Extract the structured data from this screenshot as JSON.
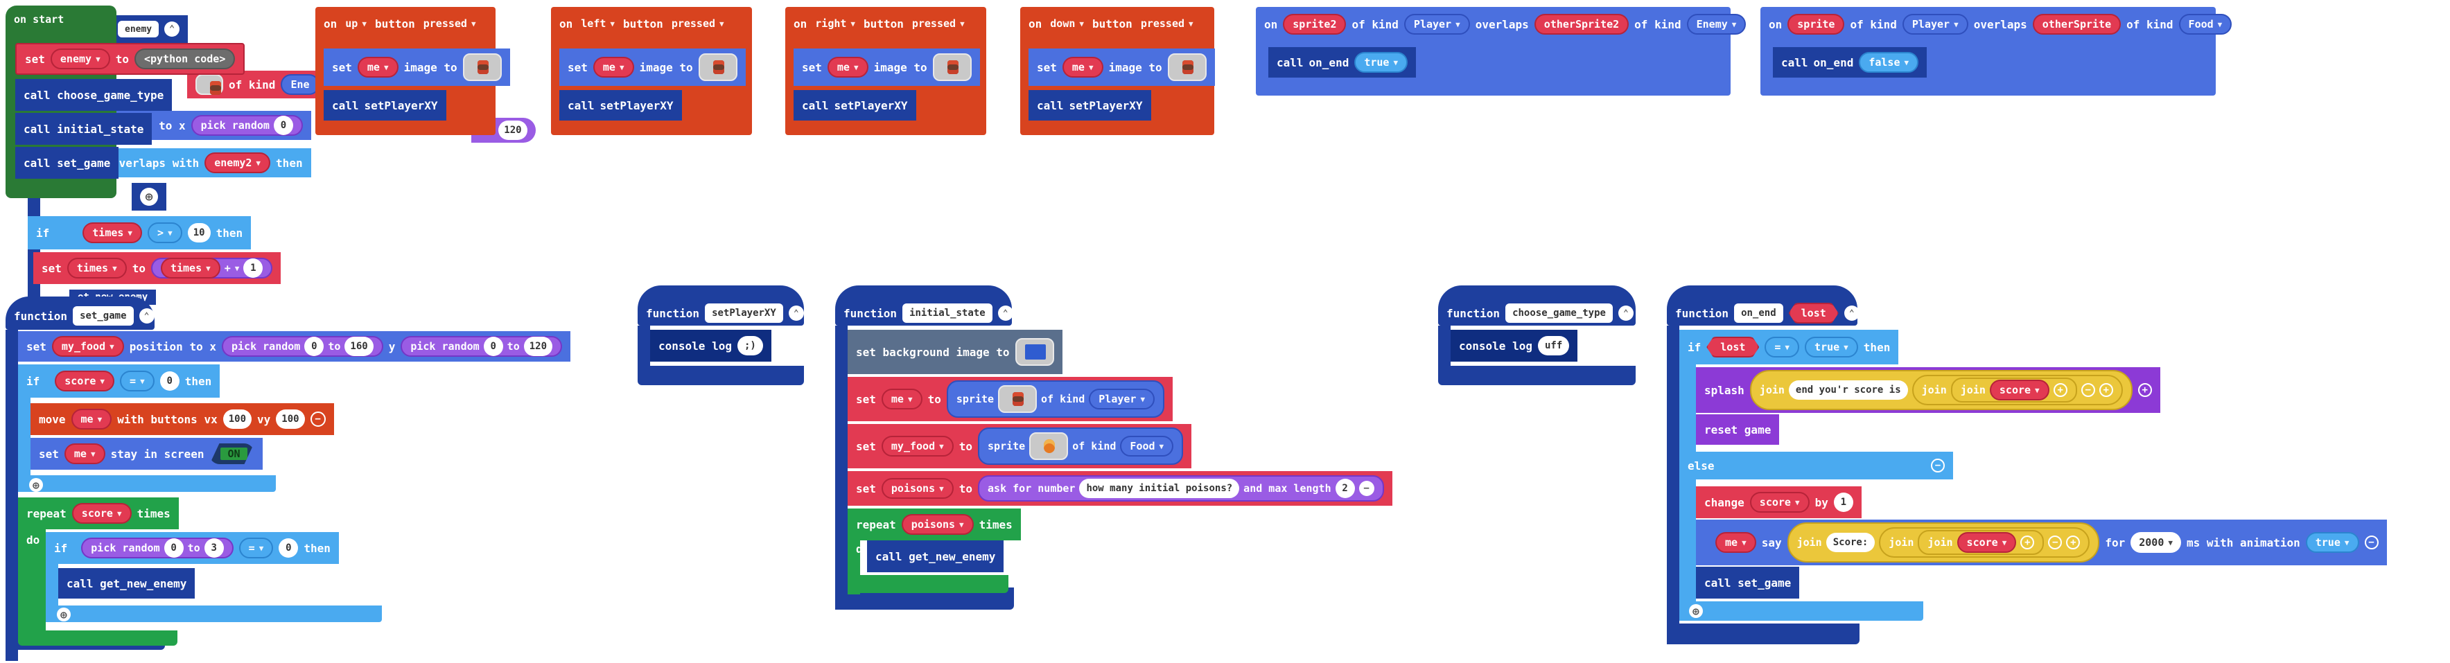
{
  "kw": {
    "on": "on",
    "set": "set",
    "to": "to",
    "call": "call",
    "function": "function",
    "button": "button",
    "pressed": "pressed",
    "image_to": "image to",
    "of_kind": "of kind",
    "overlaps": "overlaps",
    "if": "if",
    "then": "then",
    "else": "else",
    "repeat": "repeat",
    "times": "times",
    "do": "do",
    "position_to_x": "position to x",
    "y": "y",
    "pick_random": "pick random",
    "move": "move",
    "with_buttons_vx": "with buttons vx",
    "vy": "vy",
    "stay_in_screen": "stay in screen",
    "console_log": "console log",
    "set_background_image_to": "set background image to",
    "sprite": "sprite",
    "ask_for_number": "ask for number",
    "and_max_length": "and max length",
    "splash": "splash",
    "join": "join",
    "reset_game": "reset game",
    "change": "change",
    "by": "by",
    "say": "say",
    "for": "for",
    "ms_with_animation": "ms with animation",
    "overlaps_with": "overlaps with"
  },
  "on_start": {
    "title": "on start",
    "python_code": "<python code>",
    "var_enemy": "enemy",
    "calls": [
      "call choose_game_type",
      "call initial_state",
      "call set_game"
    ]
  },
  "get_new_enemy": {
    "partial_name": "enemy",
    "kind_enemy": "Ene",
    "position_partial": "osition to x",
    "rand_min": "0",
    "rand_max": "120",
    "partial_overlaps": "overlaps with",
    "enemy2": "enemy2",
    "times_var": "times",
    "op_gt": ">",
    "cmp_val": "10",
    "op_plus": "+",
    "inc_val": "1",
    "partial_call": "et_new_enemy"
  },
  "buttons": [
    {
      "dir": "up",
      "var": "me",
      "call": "setPlayerXY"
    },
    {
      "dir": "left",
      "var": "me",
      "call": "setPlayerXY"
    },
    {
      "dir": "right",
      "var": "me",
      "call": "setPlayerXY"
    },
    {
      "dir": "down",
      "var": "me",
      "call": "setPlayerXY"
    }
  ],
  "overlap_events": [
    {
      "sprite": "sprite2",
      "kind1": "Player",
      "other": "otherSprite2",
      "kind2": "Enemy",
      "call": "on_end",
      "arg": "true"
    },
    {
      "sprite": "sprite",
      "kind1": "Player",
      "other": "otherSprite",
      "kind2": "Food",
      "call": "on_end",
      "arg": "false"
    }
  ],
  "set_game": {
    "name": "set_game",
    "my_food": "my_food",
    "x_min": "0",
    "x_max": "160",
    "y_min": "0",
    "y_max": "120",
    "score": "score",
    "op_eq": "=",
    "zero": "0",
    "me": "me",
    "vx": "100",
    "vy": "100",
    "stay_toggle": "ON",
    "repeat_var": "score",
    "r_min": "0",
    "r_max": "3",
    "r_eq": "=",
    "r_val": "0",
    "call_enemy": "call get_new_enemy"
  },
  "setPlayerXY": {
    "name": "setPlayerXY",
    "log": ";)"
  },
  "initial_state": {
    "name": "initial_state",
    "me": "me",
    "kind_player": "Player",
    "my_food": "my_food",
    "kind_food": "Food",
    "poisons": "poisons",
    "prompt": "how many initial poisons?",
    "max_len": "2",
    "repeat_var": "poisons",
    "call_enemy": "call get_new_enemy"
  },
  "choose_game_type": {
    "name": "choose_game_type",
    "log": "uff"
  },
  "on_end": {
    "name": "on_end",
    "param": "lost",
    "cond_var": "lost",
    "op_eq": "=",
    "cond_val": "true",
    "splash_text": "end you'r score is ",
    "score": "score",
    "change_var": "score",
    "change_by": "1",
    "say_var": "me",
    "say_text": "Score: ",
    "say_ms": "2000",
    "anim": "true",
    "call_set_game": "call set_game"
  }
}
